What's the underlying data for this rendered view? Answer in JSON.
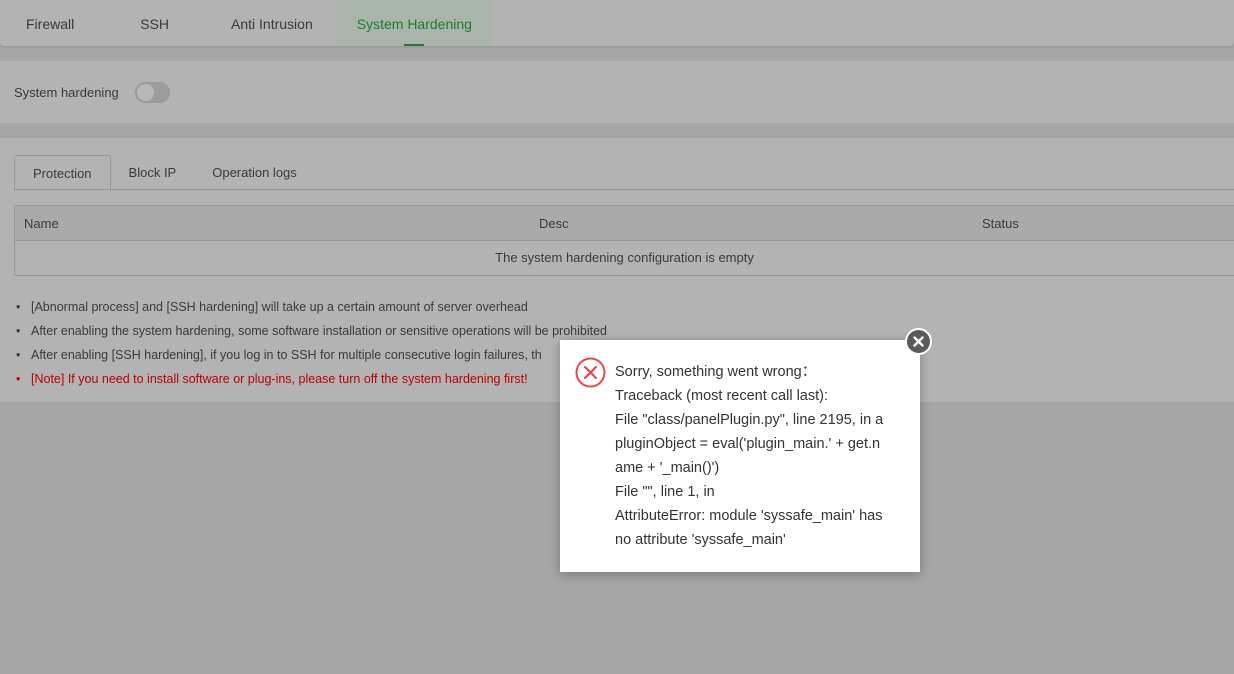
{
  "top_tabs": [
    "Firewall",
    "SSH",
    "Anti Intrusion",
    "System Hardening"
  ],
  "active_top_tab": "System Hardening",
  "toggle": {
    "label": "System hardening",
    "on": false
  },
  "sub_tabs": [
    "Protection",
    "Block IP",
    "Operation logs"
  ],
  "table": {
    "headers": [
      "Name",
      "Desc",
      "Status"
    ],
    "empty": "The system hardening configuration is empty"
  },
  "notes": [
    "[Abnormal process] and [SSH hardening] will take up a certain amount of server overhead",
    "After enabling the system hardening, some software installation or sensitive operations will be prohibited",
    "After enabling [SSH hardening], if you log in to SSH for multiple consecutive login failures, th",
    "[Note] If you need to install software or plug-ins, please turn off the system hardening first!"
  ],
  "dialog": {
    "lines": [
      "Sorry, something went wrong：",
      "Traceback (most recent call last):",
      "File \"class/panelPlugin.py\", line 2195, in a",
      "pluginObject = eval('plugin_main.' + get.n",
      "ame + '_main()')",
      "File \"\", line 1, in",
      "AttributeError: module 'syssafe_main' has",
      "no attribute 'syssafe_main'"
    ]
  },
  "colors": {
    "accent": "#1f7a32",
    "error": "#e5484d",
    "note": "#bb0000"
  }
}
